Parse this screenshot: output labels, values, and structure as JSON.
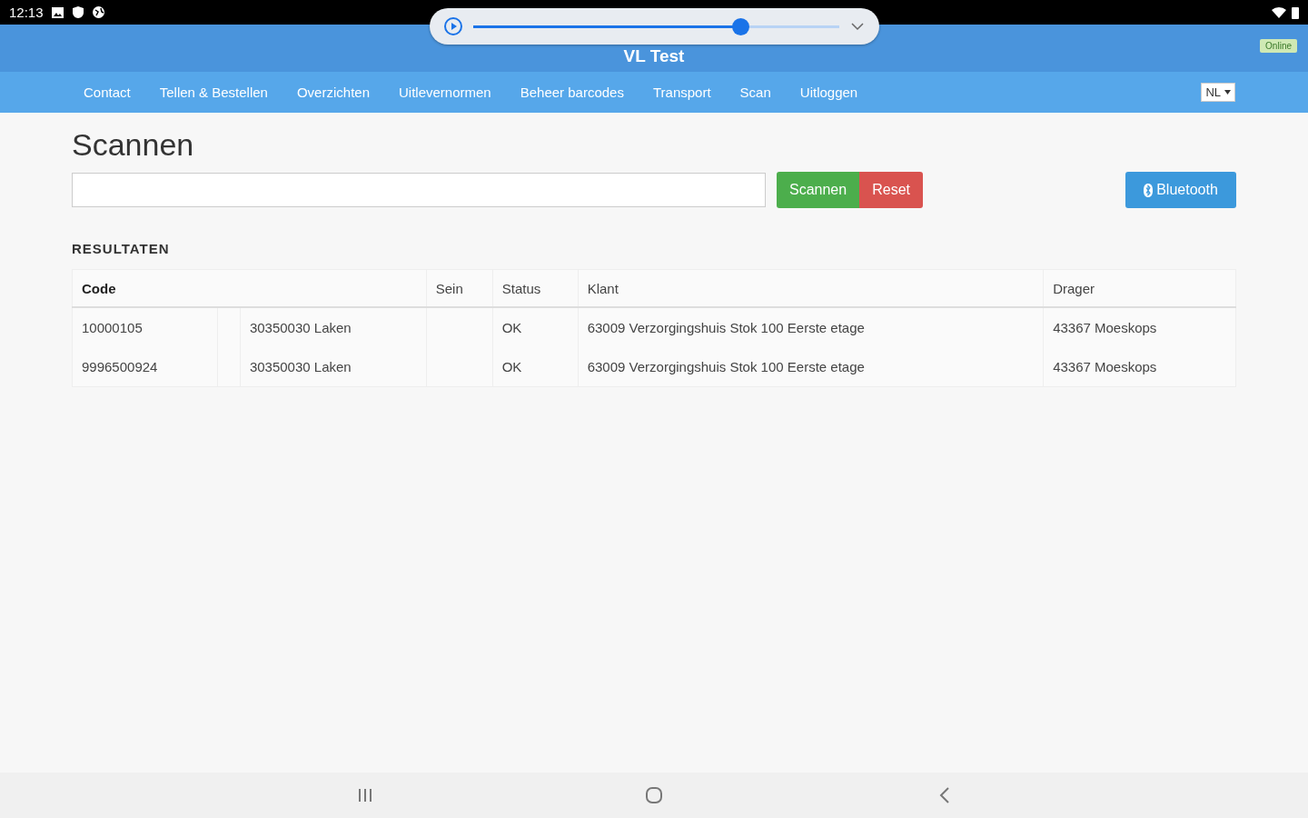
{
  "status_bar": {
    "time": "12:13"
  },
  "media_player": {
    "level": 0.73
  },
  "header": {
    "title": "VL Test",
    "connection": "Online"
  },
  "nav": {
    "items": [
      "Contact",
      "Tellen & Bestellen",
      "Overzichten",
      "Uitlevernormen",
      "Beheer barcodes",
      "Transport",
      "Scan",
      "Uitloggen"
    ],
    "language": "NL"
  },
  "page": {
    "title": "Scannen",
    "buttons": [
      {
        "label": "Scannen",
        "kind": "success"
      },
      {
        "label": "Reset",
        "kind": "danger"
      }
    ],
    "bluetooth_button": "Bluetooth"
  },
  "results": {
    "heading": "RESULTATEN",
    "columns": [
      "Code",
      "Sein",
      "Status",
      "Klant",
      "Drager"
    ],
    "rows": [
      {
        "code": "10000105",
        "item": "30350030 Laken",
        "status": "OK",
        "customer": "63009 Verzorgingshuis Stok 100 Eerste etage",
        "carrier": "43367 Moeskops"
      },
      {
        "code": "9996500924",
        "item": "30350030 Laken",
        "status": "OK",
        "customer": "63009 Verzorgingshuis Stok 100 Eerste etage",
        "carrier": "43367 Moeskops"
      }
    ]
  }
}
